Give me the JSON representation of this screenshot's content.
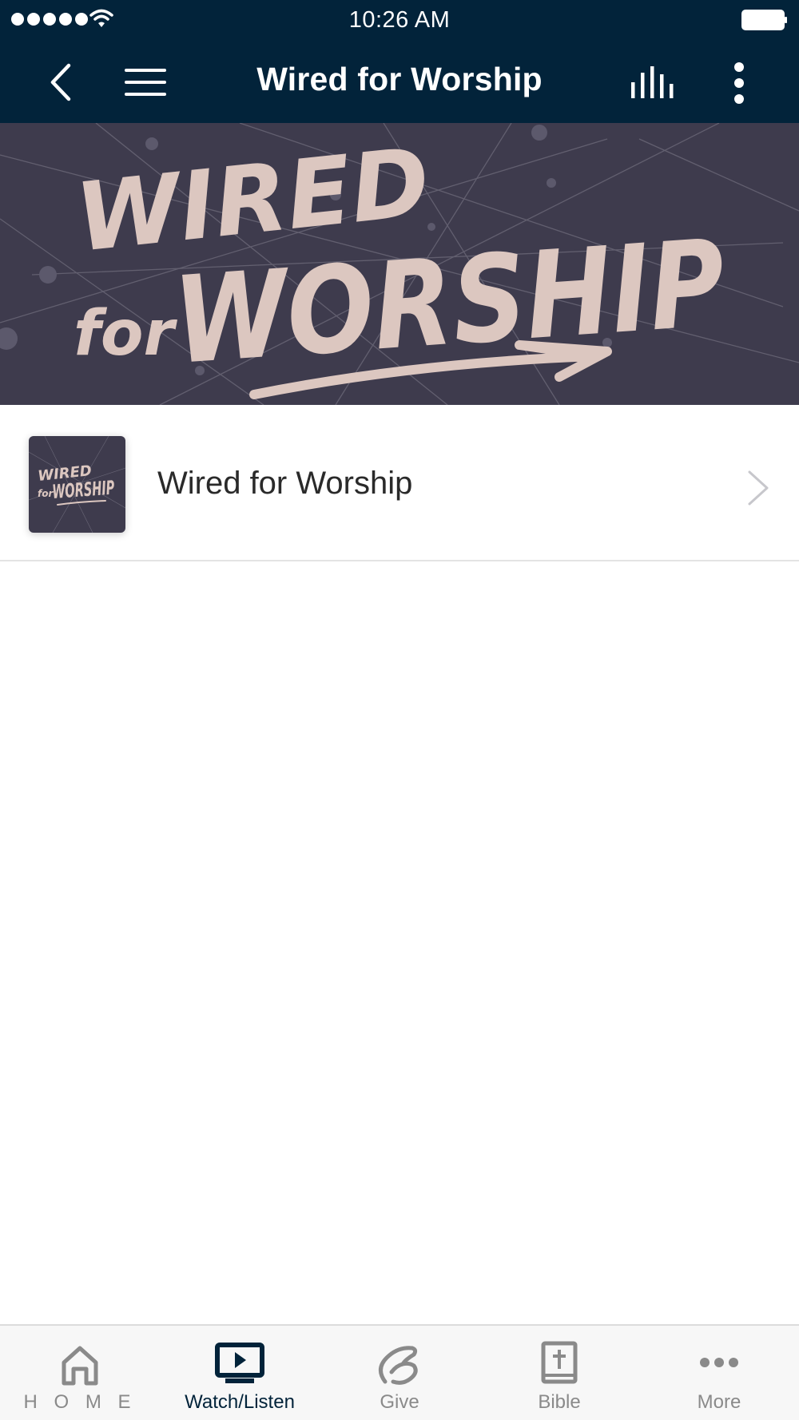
{
  "status_bar": {
    "time": "10:26 AM"
  },
  "header": {
    "title": "Wired for Worship"
  },
  "banner": {
    "artwork_line1": "WIRED",
    "artwork_line2": "for",
    "artwork_line3": "WORSHIP"
  },
  "list": {
    "items": [
      {
        "label": "Wired for Worship",
        "thumbnail": "wired-for-worship-artwork"
      }
    ]
  },
  "tabs": [
    {
      "label": "H O M E",
      "icon": "home-icon",
      "active": false
    },
    {
      "label": "Watch/Listen",
      "icon": "play-screen-icon",
      "active": true
    },
    {
      "label": "Give",
      "icon": "give-icon",
      "active": false
    },
    {
      "label": "Bible",
      "icon": "bible-icon",
      "active": false
    },
    {
      "label": "More",
      "icon": "more-dots-icon",
      "active": false
    }
  ],
  "colors": {
    "header_bg": "#02233a",
    "banner_bg": "#3e3b4d",
    "artwork_text": "#dcc7c0",
    "tab_active": "#02233a",
    "tab_inactive": "#8a8a8a"
  }
}
